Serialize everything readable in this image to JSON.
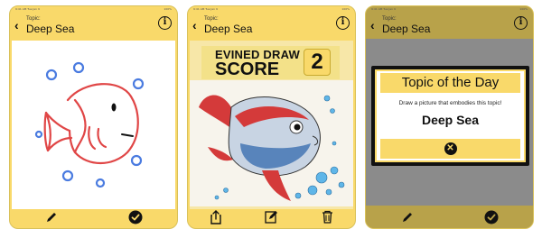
{
  "statusbar": {
    "left": "9:41 AM Tue Jan 9",
    "right": "100%"
  },
  "screens": [
    {
      "topic_label": "Topic:",
      "topic_value": "Deep Sea",
      "info_label": "i"
    },
    {
      "topic_label": "Topic:",
      "topic_value": "Deep Sea",
      "info_label": "i",
      "score": {
        "line1": "EVINED DRAW",
        "line2": "SCORE",
        "value": "2"
      }
    },
    {
      "topic_label": "Topic:",
      "topic_value": "Deep Sea",
      "info_label": "i",
      "modal": {
        "title": "Topic of the Day",
        "subtitle": "Draw a picture that embodies this topic!",
        "topic": "Deep Sea"
      }
    }
  ],
  "colors": {
    "accent_yellow": "#f9d96a",
    "dark": "#111111",
    "drawing_red": "#e04646",
    "bubble_blue": "#4a7be0"
  },
  "icons": [
    "chevron-left-icon",
    "info-icon",
    "pencil-icon",
    "checkmark-circle-icon",
    "share-icon",
    "edit-icon",
    "trash-icon",
    "close-icon"
  ]
}
